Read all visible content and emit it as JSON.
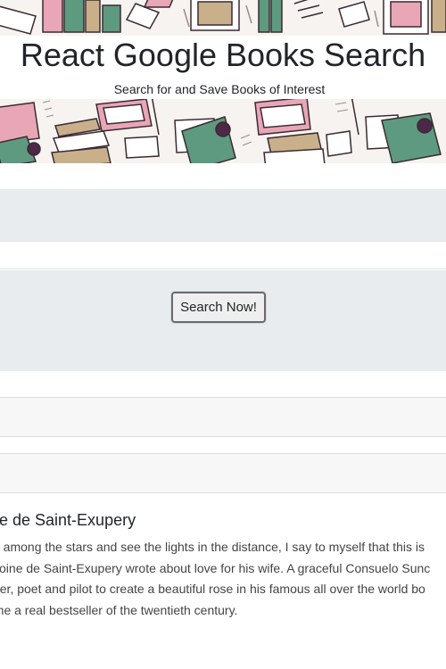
{
  "header": {
    "title": "React Google Books Search",
    "subtitle": "Search for and Save Books of Interest"
  },
  "search": {
    "input_value": "",
    "input_placeholder": "",
    "button_label": "Search Now!"
  },
  "results": [
    {
      "author": "Antoine de Saint-Exupery",
      "author_visible": "e de Saint-Exupery",
      "description_lines": [
        "I fly among the stars and see the lights in the distance, I say to myself that this is",
        "Antoine de Saint-Exupery wrote about love for his wife. A graceful Consuelo Sunc",
        "writer, poet and pilot to create a beautiful rose in his famous all over the world bo",
        "came a real bestseller of the twentieth century."
      ]
    }
  ],
  "colors": {
    "jumbotron_bg": "#e9ecef",
    "card_header_bg": "#f7f7f7",
    "text": "#212529",
    "pattern_bg": "#f7f3f0",
    "book_green": "#5d9a7f",
    "book_pink": "#e9a6b6",
    "book_tan": "#c9b08a",
    "ink_dark": "#3a2a33",
    "ink_purple": "#4d2848"
  }
}
